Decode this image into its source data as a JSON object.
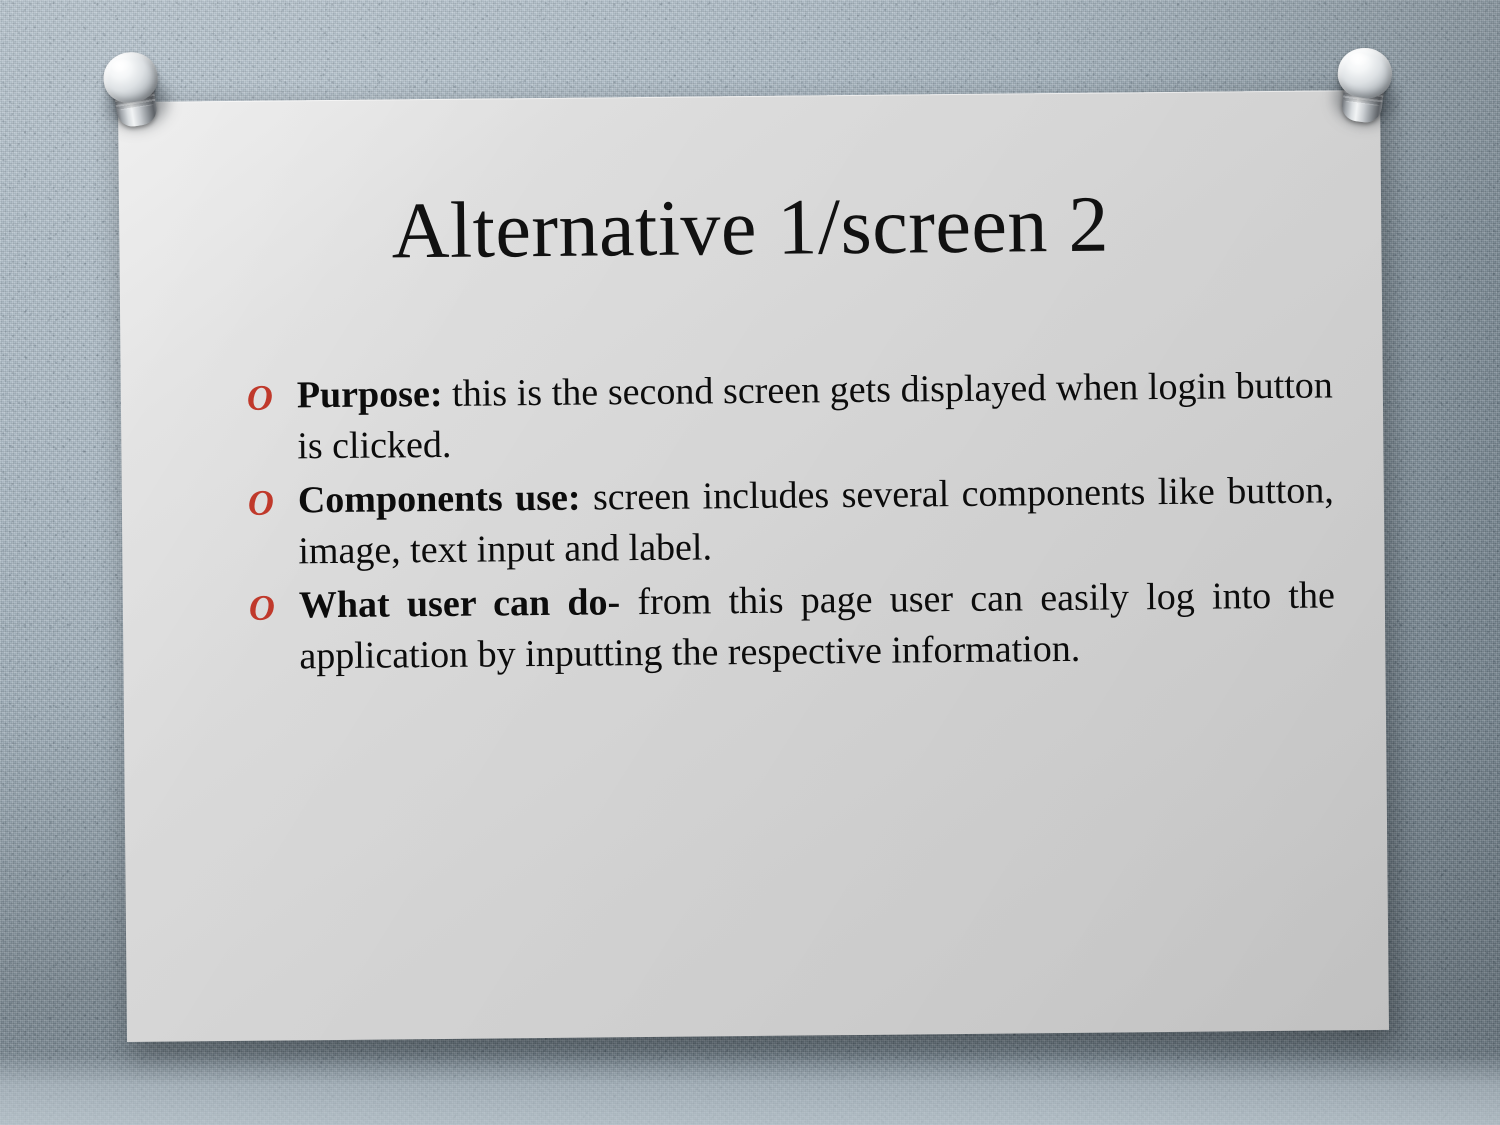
{
  "slide": {
    "title": "Alternative 1/screen 2",
    "bullet_marker": "O",
    "bullet_marker_icon": "ring-o-bullet-icon",
    "accent_color": "#C0392B",
    "card_color": "#D2D2D2",
    "background_color": "#9FB0BC",
    "text_color": "#0C0C0C",
    "bullets": [
      {
        "lead": "Purpose:",
        "body": " this is the second screen gets displayed when login button is clicked.",
        "full_text": "Purpose: this is the second screen gets displayed when login button is clicked."
      },
      {
        "lead": "Components use:",
        "body": " screen includes several components like button, image, text input and label.",
        "full_text": "Components use: screen includes several components like button, image, text input and label."
      },
      {
        "lead": "What user can do-",
        "body": " from this page user can easily log into the application by inputting the respective information.",
        "full_text": "What user can do- from this page user can easily log into the application by inputting the respective information."
      }
    ],
    "pins": [
      {
        "name": "top-left-pushpin"
      },
      {
        "name": "top-right-pushpin"
      }
    ]
  }
}
